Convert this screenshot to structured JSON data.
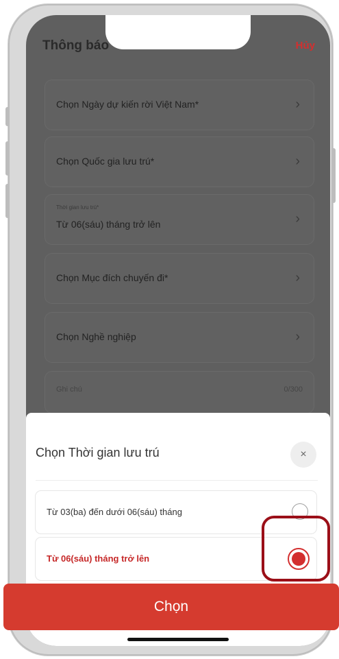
{
  "header": {
    "title": "Thông báo",
    "cancel": "Hủy"
  },
  "form": {
    "rows": [
      {
        "label": "Chọn Ngày dự kiến rời Việt Nam*"
      },
      {
        "label": "Chọn Quốc gia lưu trú*"
      },
      {
        "small_label": "Thời gian lưu trú*",
        "value": "Từ 06(sáu) tháng trở lên"
      },
      {
        "label": "Chọn Mục đích chuyến đi*"
      },
      {
        "label": "Chọn Nghề nghiệp"
      }
    ],
    "note": {
      "placeholder": "Ghi chú",
      "counter": "0/300"
    }
  },
  "sheet": {
    "title": "Chọn Thời gian lưu trú",
    "close": "×",
    "options": [
      {
        "label": "Từ 03(ba) đến dưới 06(sáu) tháng",
        "selected": false
      },
      {
        "label": "Từ 06(sáu) tháng trở lên",
        "selected": true
      }
    ]
  },
  "cta": {
    "label": "Chọn"
  },
  "icons": {
    "chevron": "chevron-right-icon",
    "close": "close-icon"
  },
  "colors": {
    "accent": "#d53b2f",
    "selected_text": "#c62828",
    "highlight_border": "#9b0f18"
  }
}
